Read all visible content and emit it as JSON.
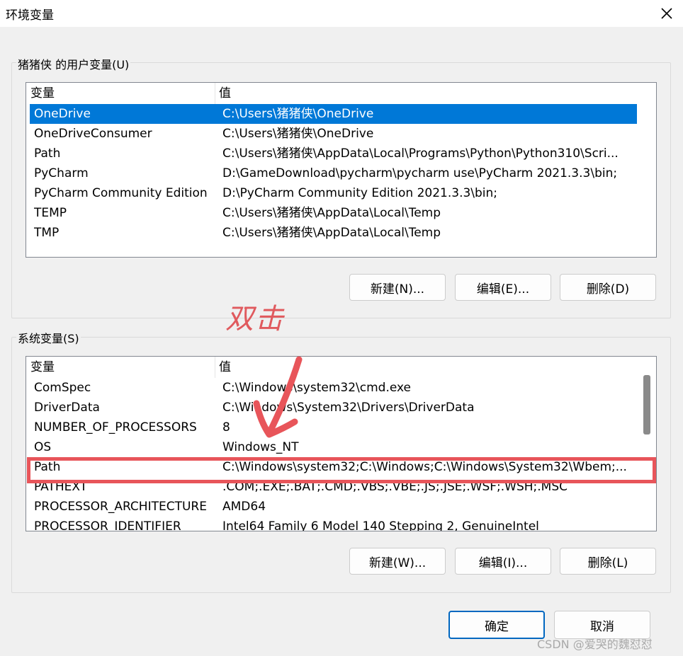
{
  "window": {
    "title": "环境变量",
    "close_icon": "close-icon"
  },
  "user_vars": {
    "group_label": "猪猪侠 的用户变量(U)",
    "columns": [
      "变量",
      "值"
    ],
    "rows": [
      {
        "name": "OneDrive",
        "value": "C:\\Users\\猪猪侠\\OneDrive",
        "selected": true
      },
      {
        "name": "OneDriveConsumer",
        "value": "C:\\Users\\猪猪侠\\OneDrive"
      },
      {
        "name": "Path",
        "value": "C:\\Users\\猪猪侠\\AppData\\Local\\Programs\\Python\\Python310\\Scri..."
      },
      {
        "name": "PyCharm",
        "value": "D:\\GameDownload\\pycharm\\pycharm use\\PyCharm 2021.3.3\\bin;"
      },
      {
        "name": "PyCharm Community Edition",
        "value": "D:\\PyCharm Community Edition 2021.3.3\\bin;"
      },
      {
        "name": "TEMP",
        "value": "C:\\Users\\猪猪侠\\AppData\\Local\\Temp"
      },
      {
        "name": "TMP",
        "value": "C:\\Users\\猪猪侠\\AppData\\Local\\Temp"
      }
    ],
    "buttons": {
      "new": "新建(N)...",
      "edit": "编辑(E)...",
      "delete": "删除(D)"
    }
  },
  "system_vars": {
    "group_label": "系统变量(S)",
    "columns": [
      "变量",
      "值"
    ],
    "rows": [
      {
        "name": "ComSpec",
        "value": "C:\\Windows\\system32\\cmd.exe"
      },
      {
        "name": "DriverData",
        "value": "C:\\Windows\\System32\\Drivers\\DriverData"
      },
      {
        "name": "NUMBER_OF_PROCESSORS",
        "value": "8"
      },
      {
        "name": "OS",
        "value": "Windows_NT"
      },
      {
        "name": "Path",
        "value": "C:\\Windows\\system32;C:\\Windows;C:\\Windows\\System32\\Wbem;..."
      },
      {
        "name": "PATHEXT",
        "value": ".COM;.EXE;.BAT;.CMD;.VBS;.VBE;.JS;.JSE;.WSF;.WSH;.MSC"
      },
      {
        "name": "PROCESSOR_ARCHITECTURE",
        "value": "AMD64"
      },
      {
        "name": "PROCESSOR_IDENTIFIER",
        "value": "Intel64 Family 6 Model 140 Stepping 2, GenuineIntel"
      }
    ],
    "buttons": {
      "new": "新建(W)...",
      "edit": "编辑(I)...",
      "delete": "删除(L)"
    }
  },
  "dialog_buttons": {
    "ok": "确定",
    "cancel": "取消"
  },
  "annotation": {
    "text": "双击",
    "color": "#e8555a"
  },
  "watermark": "CSDN @爱哭的魏怼怼",
  "colors": {
    "selection": "#0078d7",
    "primary_border": "#0067c0"
  }
}
